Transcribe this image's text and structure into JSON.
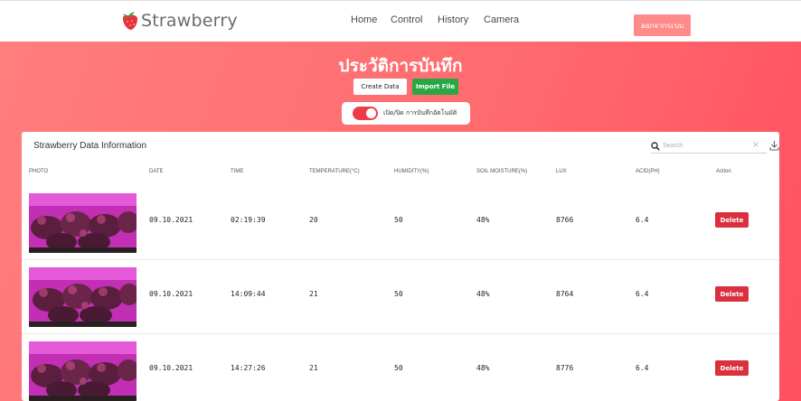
{
  "navbar": {
    "brand": "Strawberry",
    "links": [
      "Home",
      "Control",
      "History",
      "Camera"
    ],
    "logout_label": "ออกจากระบบ"
  },
  "hero": {
    "title": "ประวัติการบันทึก",
    "create_label": "Create Data",
    "import_label": "Import File",
    "auto_record_label": "เปิด/ปิด การบันทึกอัตโนมัติ",
    "auto_record_on": true
  },
  "table": {
    "title": "Strawberry Data Information",
    "search_placeholder": "Search",
    "columns": [
      "PHOTO",
      "DATE",
      "TIME",
      "TEMPERATURE(°C)",
      "HUMIDITY(%)",
      "SOIL MOISTURE(%)",
      "LUX",
      "ACID(pH)",
      "Action"
    ],
    "rows": [
      {
        "date": "09.10.2021",
        "time": "02:19:39",
        "temperature": "20",
        "humidity": "50",
        "soil_moisture": "48%",
        "lux": "8766",
        "acid": "6.4",
        "action": "Delete"
      },
      {
        "date": "09.10.2021",
        "time": "14:09:44",
        "temperature": "21",
        "humidity": "50",
        "soil_moisture": "48%",
        "lux": "8764",
        "acid": "6.4",
        "action": "Delete"
      },
      {
        "date": "09.10.2021",
        "time": "14:27:26",
        "temperature": "21",
        "humidity": "50",
        "soil_moisture": "48%",
        "lux": "8776",
        "acid": "6.4",
        "action": "Delete"
      }
    ]
  },
  "colors": {
    "brand_red": "#ee3b49",
    "hero_gradient_start": "#ff7e7e",
    "hero_gradient_end": "#ff5060",
    "import_green": "#28a745",
    "delete_red": "#d9313f",
    "logout_pink": "#ff8a8a"
  },
  "icons": [
    "strawberry-logo-icon",
    "search-icon",
    "clear-icon",
    "download-icon"
  ]
}
